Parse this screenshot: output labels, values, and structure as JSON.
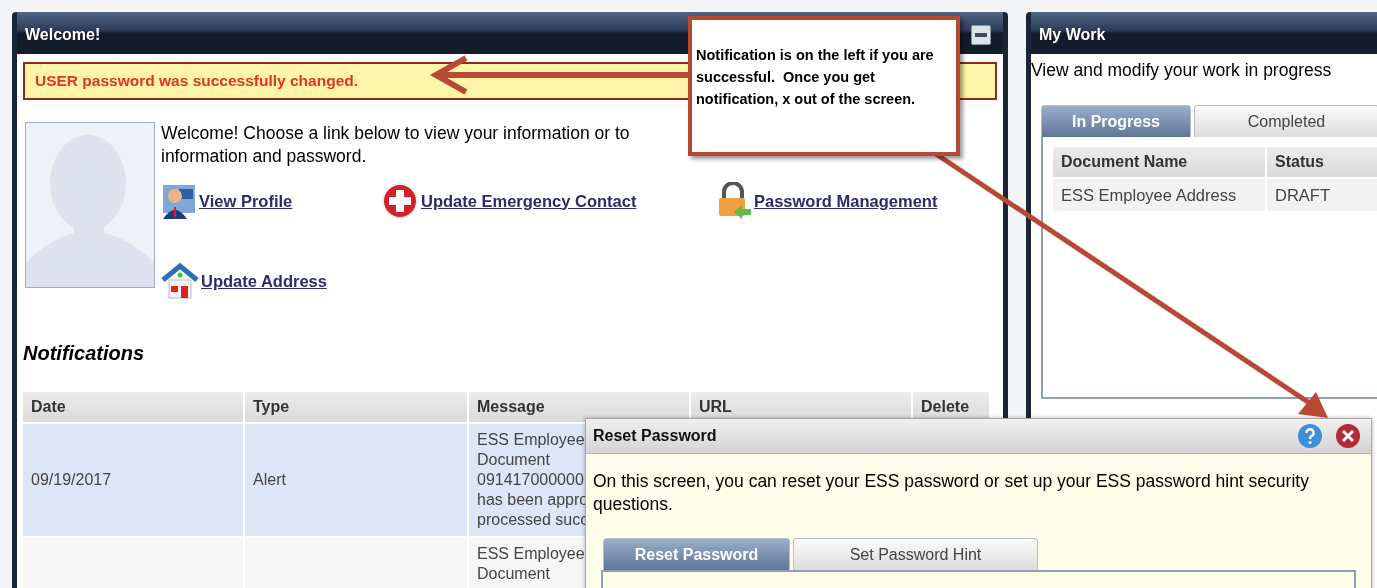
{
  "welcome_panel": {
    "title": "Welcome!",
    "notice": "USER password was successfully changed.",
    "intro_lines": [
      "Welcome! Choose a link below to view your information or to",
      "information and password."
    ],
    "links": [
      {
        "kind": "profile",
        "label": "View Profile"
      },
      {
        "kind": "emergency",
        "label": "Update Emergency Contact"
      },
      {
        "kind": "password",
        "label": "Password Management"
      },
      {
        "kind": "address",
        "label": "Update Address"
      }
    ],
    "notifications": {
      "title": "Notifications",
      "columns": [
        "Date",
        "Type",
        "Message",
        "URL",
        "Delete"
      ],
      "rows": [
        {
          "date": "09/19/2017",
          "type": "Alert",
          "message_lines": [
            "ESS Employee",
            "Document",
            "091417000000",
            "has been appro",
            "processed succ"
          ],
          "selected": true
        },
        {
          "date": "",
          "type": "",
          "message_lines": [
            "ESS Employee",
            "Document"
          ],
          "selected": false
        }
      ]
    }
  },
  "my_work": {
    "title": "My Work",
    "description": "View and modify your work in progress",
    "tabs": [
      {
        "label": "In Progress",
        "selected": true
      },
      {
        "label": "Completed",
        "selected": false
      }
    ],
    "columns": [
      "Document Name",
      "Status"
    ],
    "rows": [
      {
        "document_name": "ESS Employee Address",
        "status": "DRAFT"
      }
    ]
  },
  "dialog": {
    "title": "Reset Password",
    "text": "On this screen, you can reset your ESS password or set up your ESS password hint security questions.",
    "tabs": [
      {
        "label": "Reset Password",
        "selected": true
      },
      {
        "label": "Set Password Hint",
        "selected": false
      }
    ]
  },
  "annotation": {
    "text": "Notification is on the left if you are successful.  Once you get notification, x out of the screen."
  }
}
